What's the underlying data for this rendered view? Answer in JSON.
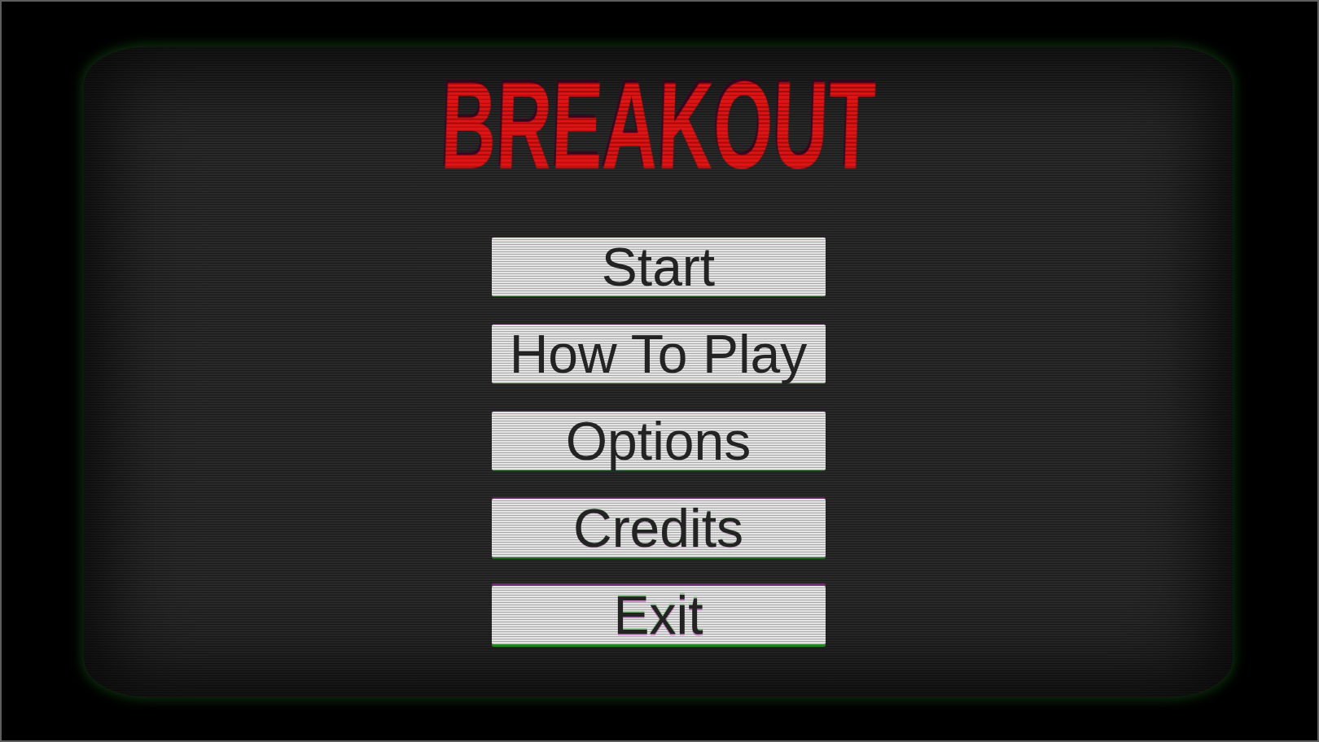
{
  "title": "BREAKOUT",
  "menu": [
    {
      "label": "Start"
    },
    {
      "label": "How To Play"
    },
    {
      "label": "Options"
    },
    {
      "label": "Credits"
    },
    {
      "label": "Exit"
    }
  ]
}
